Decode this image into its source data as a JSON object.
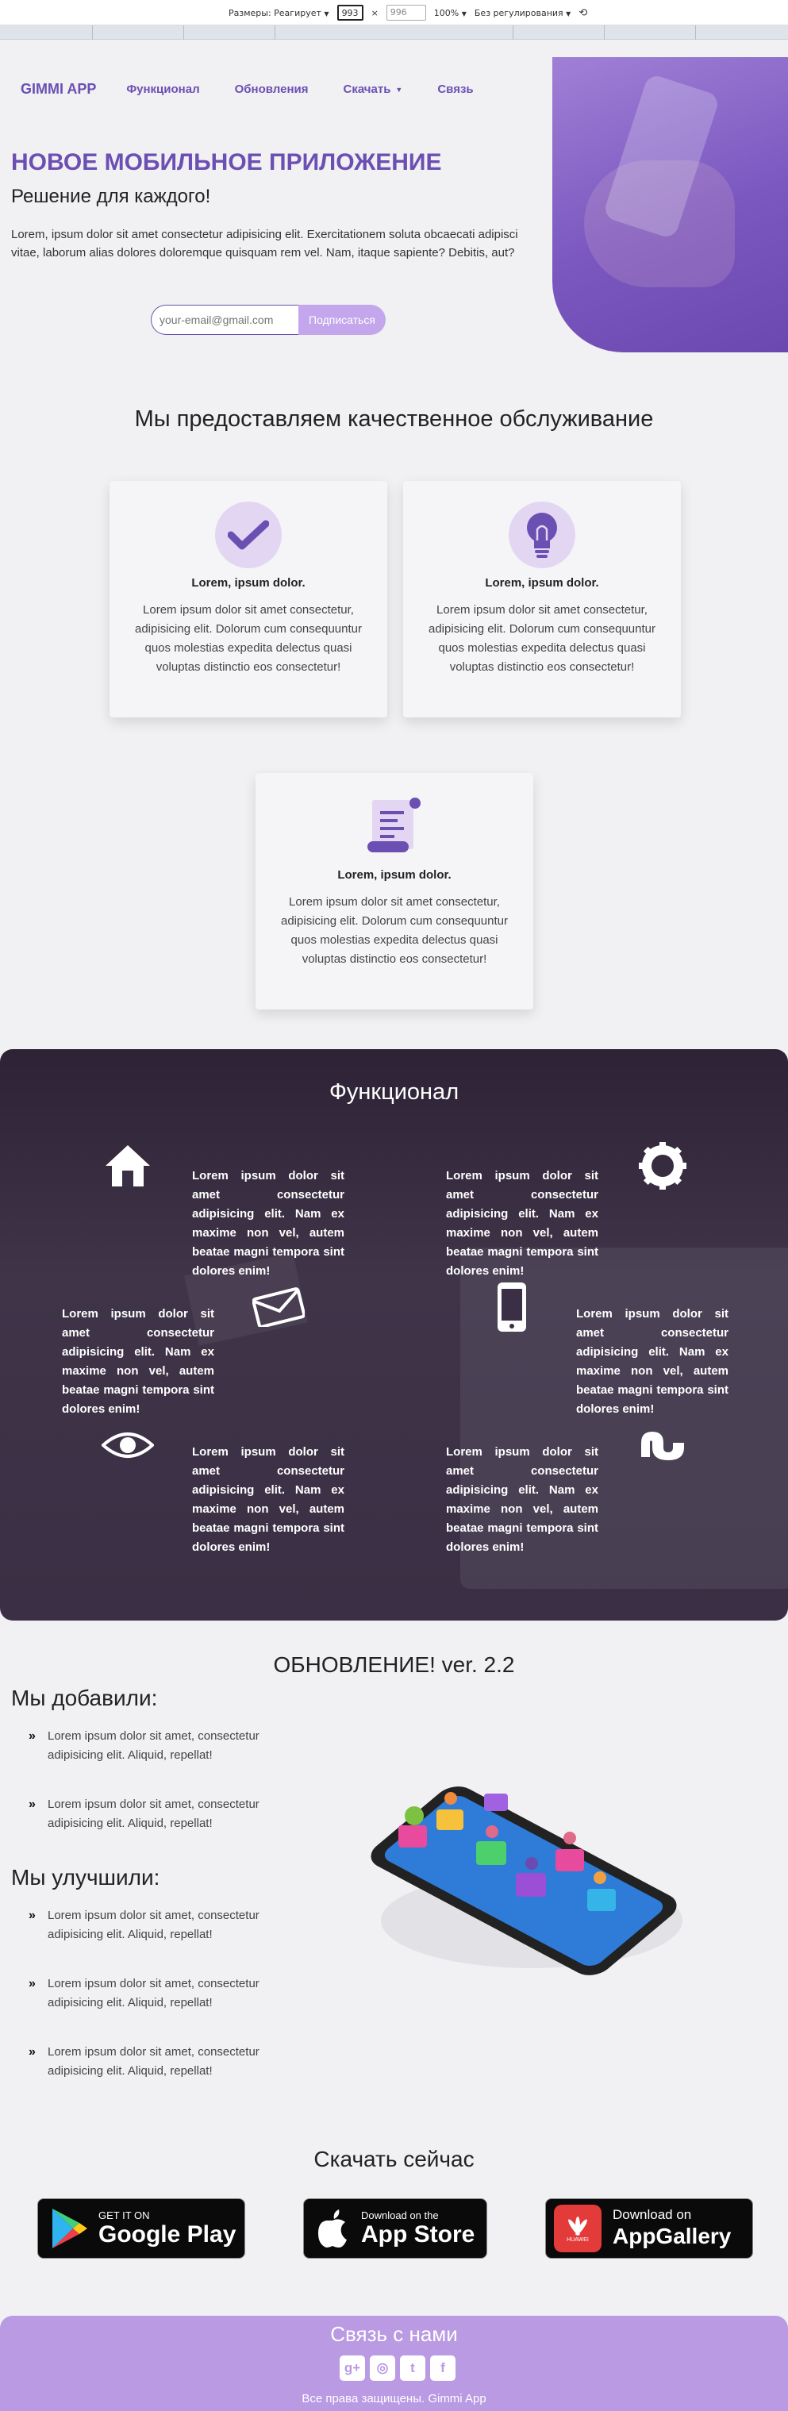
{
  "devtools": {
    "size_label": "Размеры: Реагирует",
    "width": "993",
    "height": "996",
    "zoom": "100%",
    "throttle": "Без регулирования"
  },
  "hero": {
    "brand": "GIMMI APP",
    "nav": [
      "Функционал",
      "Обновления",
      "Скачать",
      "Связь"
    ],
    "title": "НОВОЕ МОБИЛЬНОЕ ПРИЛОЖЕНИЕ",
    "subtitle": "Решение для каждого!",
    "lead": "Lorem, ipsum dolor sit amet consectetur adipisicing elit. Exercitationem soluta obcaecati adipisci vitae, laborum alias dolores doloremque quisquam rem vel. Nam, itaque sapiente? Debitis, aut?",
    "email_placeholder": "your-email@gmail.com",
    "subscribe_label": "Подписаться"
  },
  "services": {
    "title": "Мы предоставляем качественное обслуживание",
    "cards": [
      {
        "icon": "check-icon",
        "title": "Lorem, ipsum dolor.",
        "text": "Lorem ipsum dolor sit amet consectetur, adipisicing elit. Dolorum cum consequuntur quos molestias expedita delectus quasi voluptas distinctio eos consectetur!"
      },
      {
        "icon": "lightbulb-icon",
        "title": "Lorem, ipsum dolor.",
        "text": "Lorem ipsum dolor sit amet consectetur, adipisicing elit. Dolorum cum consequuntur quos molestias expedita delectus quasi voluptas distinctio eos consectetur!"
      },
      {
        "icon": "scroll-icon",
        "title": "Lorem, ipsum dolor.",
        "text": "Lorem ipsum dolor sit amet consectetur, adipisicing elit. Dolorum cum consequuntur quos molestias expedita delectus quasi voluptas distinctio eos consectetur!"
      }
    ]
  },
  "features": {
    "title": "Функционал",
    "items": [
      {
        "icon": "home-icon",
        "text": "Lorem ipsum dolor sit amet consectetur adipisicing elit. Nam ex maxime non vel, autem beatae magni tempora sint dolores enim!"
      },
      {
        "icon": "gear-icon",
        "text": "Lorem ipsum dolor sit amet consectetur adipisicing elit. Nam ex maxime non vel, autem beatae magni tempora sint dolores enim!"
      },
      {
        "icon": "envelope-icon",
        "text": "Lorem ipsum dolor sit amet consectetur adipisicing elit. Nam ex maxime non vel, autem beatae magni tempora sint dolores enim!"
      },
      {
        "icon": "mobile-icon",
        "text": "Lorem ipsum dolor sit amet consectetur adipisicing elit. Nam ex maxime non vel, autem beatae magni tempora sint dolores enim!"
      },
      {
        "icon": "eye-icon",
        "text": "Lorem ipsum dolor sit amet consectetur adipisicing elit. Nam ex maxime non vel, autem beatae magni tempora sint dolores enim!"
      },
      {
        "icon": "stumbleupon-icon",
        "text": "Lorem ipsum dolor sit amet consectetur adipisicing elit. Nam ex maxime non vel, autem beatae magni tempora sint dolores enim!"
      }
    ]
  },
  "updates": {
    "title": "ОБНОВЛЕНИЕ! ver. 2.2",
    "added_heading": "Мы добавили:",
    "added": [
      "Lorem ipsum dolor sit amet, consectetur adipisicing elit. Aliquid, repellat!",
      "Lorem ipsum dolor sit amet, consectetur adipisicing elit. Aliquid, repellat!"
    ],
    "improved_heading": "Мы улучшили:",
    "improved": [
      "Lorem ipsum dolor sit amet, consectetur adipisicing elit. Aliquid, repellat!",
      "Lorem ipsum dolor sit amet, consectetur adipisicing elit. Aliquid, repellat!",
      "Lorem ipsum dolor sit amet, consectetur adipisicing elit. Aliquid, repellat!"
    ]
  },
  "download": {
    "title": "Скачать сейчас",
    "google": {
      "small": "GET IT ON",
      "big": "Google Play"
    },
    "apple": {
      "small": "Download on the",
      "big": "App Store"
    },
    "huawei": {
      "small": "Download on",
      "big": "AppGallery",
      "logo_text": "HUAWEI"
    }
  },
  "footer": {
    "title": "Связь с нами",
    "social": [
      "google-plus-icon",
      "instagram-icon",
      "twitter-icon",
      "facebook-icon"
    ],
    "copyright": "Все права защищены. Gimmi App"
  },
  "colors": {
    "accent": "#6b4fb3",
    "accent_light": "#c3a6ec",
    "footer": "#b99ae3",
    "dark_section": "#3a2f44"
  }
}
